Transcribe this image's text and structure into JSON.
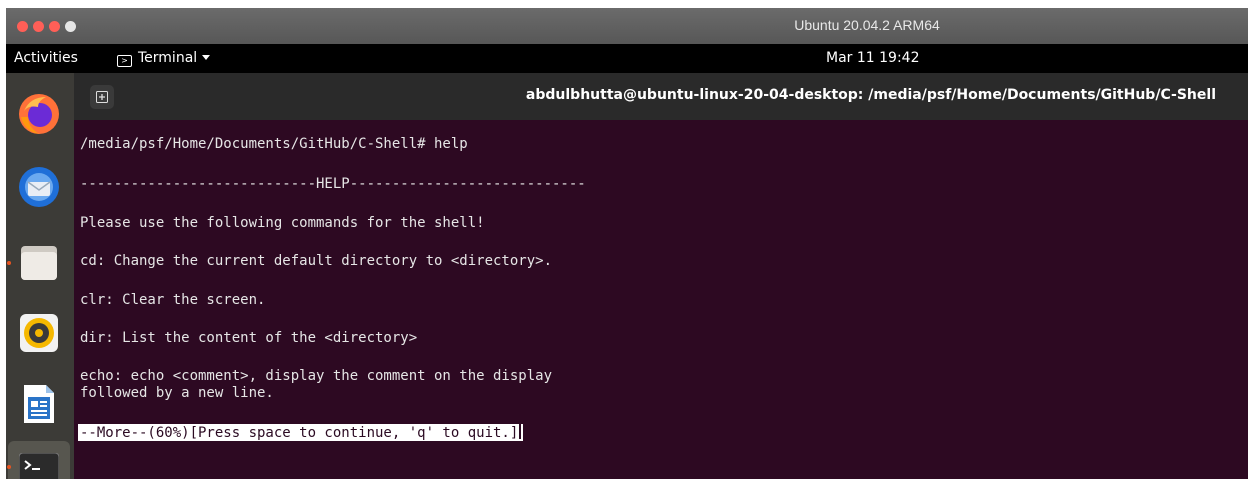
{
  "vm": {
    "title": "Ubuntu 20.04.2 ARM64"
  },
  "topbar": {
    "activities": "Activities",
    "app_name": "Terminal",
    "clock": "Mar 11  19:42"
  },
  "dock": {
    "items": [
      {
        "name": "Firefox",
        "icon": "firefox-icon"
      },
      {
        "name": "Thunderbird",
        "icon": "thunderbird-icon"
      },
      {
        "name": "Files",
        "icon": "files-icon"
      },
      {
        "name": "Rhythmbox",
        "icon": "rhythmbox-icon"
      },
      {
        "name": "LibreOffice Writer",
        "icon": "libreoffice-writer-icon"
      },
      {
        "name": "Terminal",
        "icon": "terminal-icon"
      }
    ]
  },
  "terminal": {
    "title": "abdulbhutta@ubuntu-linux-20-04-desktop: /media/psf/Home/Documents/GitHub/C-Shell",
    "lines": [
      "/media/psf/Home/Documents/GitHub/C-Shell# help",
      "----------------------------HELP----------------------------",
      "Please use the following commands for the shell!",
      "cd: Change the current default directory to <directory>.",
      "clr: Clear the screen.",
      "dir: List the content of the <directory>",
      "echo: echo <comment>, display the comment on the display",
      "followed by a new line."
    ],
    "more_prompt": "--More--(60%)[Press space to continue, 'q' to quit.]"
  },
  "colors": {
    "terminal_bg": "#2d0922",
    "dock_bg": "#3c3b37",
    "accent": "#e95420"
  }
}
